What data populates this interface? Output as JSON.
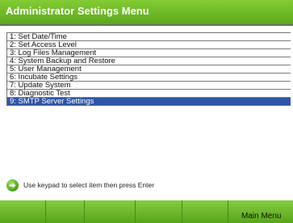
{
  "header": {
    "title": "Administrator Settings Menu"
  },
  "menu": {
    "items": [
      {
        "label": "1: Set Date/Time",
        "selected": false
      },
      {
        "label": "2: Set Access Level",
        "selected": false
      },
      {
        "label": "3: Log Files Management",
        "selected": false
      },
      {
        "label": "4: System Backup and Restore",
        "selected": false
      },
      {
        "label": "5: User Management",
        "selected": false
      },
      {
        "label": "6: Incubate Settings",
        "selected": false
      },
      {
        "label": "7: Update System",
        "selected": false
      },
      {
        "label": "8: Diagnostic Test",
        "selected": false
      },
      {
        "label": "9: SMTP Server Settings",
        "selected": true
      }
    ]
  },
  "hint": {
    "icon": "green-arrow-icon",
    "text": "Use keypad to select item then press Enter"
  },
  "softkeys": [
    {
      "label": ""
    },
    {
      "label": ""
    },
    {
      "label": ""
    },
    {
      "label": ""
    },
    {
      "label": ""
    },
    {
      "label": "Main Menu"
    }
  ],
  "colors": {
    "title_green": "#6cb92a",
    "selection_blue": "#2f55a7",
    "softkey_green": "#6fbb2e"
  }
}
